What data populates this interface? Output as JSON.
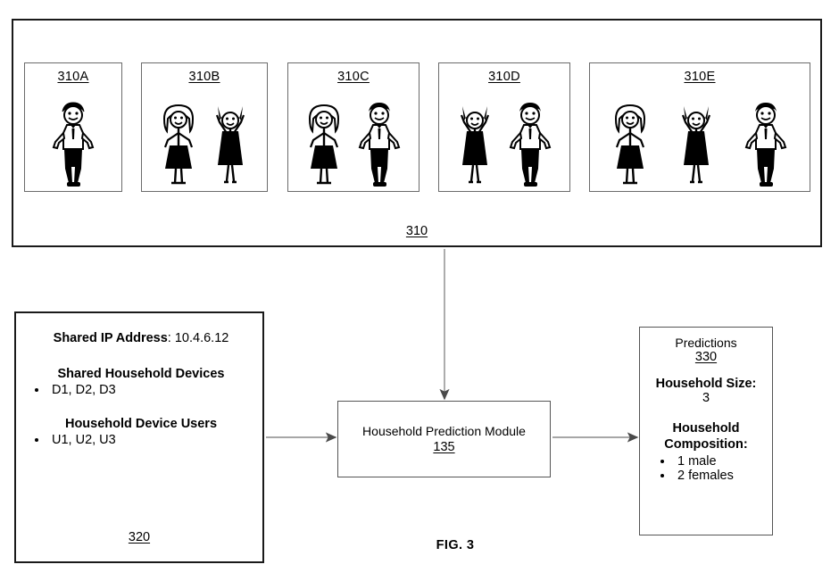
{
  "figure": {
    "caption": "FIG. 3"
  },
  "group_310": {
    "ref": "310",
    "panels": [
      {
        "label": "310A",
        "members": [
          "male"
        ]
      },
      {
        "label": "310B",
        "members": [
          "female-hips",
          "female-arms-up"
        ]
      },
      {
        "label": "310C",
        "members": [
          "female-hips",
          "male"
        ]
      },
      {
        "label": "310D",
        "members": [
          "female-arms-up",
          "male"
        ]
      },
      {
        "label": "310E",
        "members": [
          "female-hips",
          "female-arms-up",
          "male"
        ]
      }
    ]
  },
  "box_320": {
    "ref": "320",
    "ip_label": "Shared IP Address",
    "ip_separator": ": ",
    "ip_value": "10.4.6.12",
    "devices_heading": "Shared Household Devices",
    "devices_items": [
      "D1, D2, D3"
    ],
    "users_heading": "Household Device Users",
    "users_items": [
      "U1, U2, U3"
    ]
  },
  "module_135": {
    "title": "Household Prediction Module",
    "ref": "135"
  },
  "predictions_330": {
    "title": "Predictions",
    "ref": "330",
    "size_label": "Household Size:",
    "size_value": "3",
    "composition_label": "Household Composition:",
    "composition_items": [
      "1 male",
      "2 females"
    ]
  },
  "colors": {
    "ink": "#000000",
    "outer_border": "#1a1a1a",
    "panel_border": "#6b6b6b",
    "connector": "#6b6b6b"
  }
}
